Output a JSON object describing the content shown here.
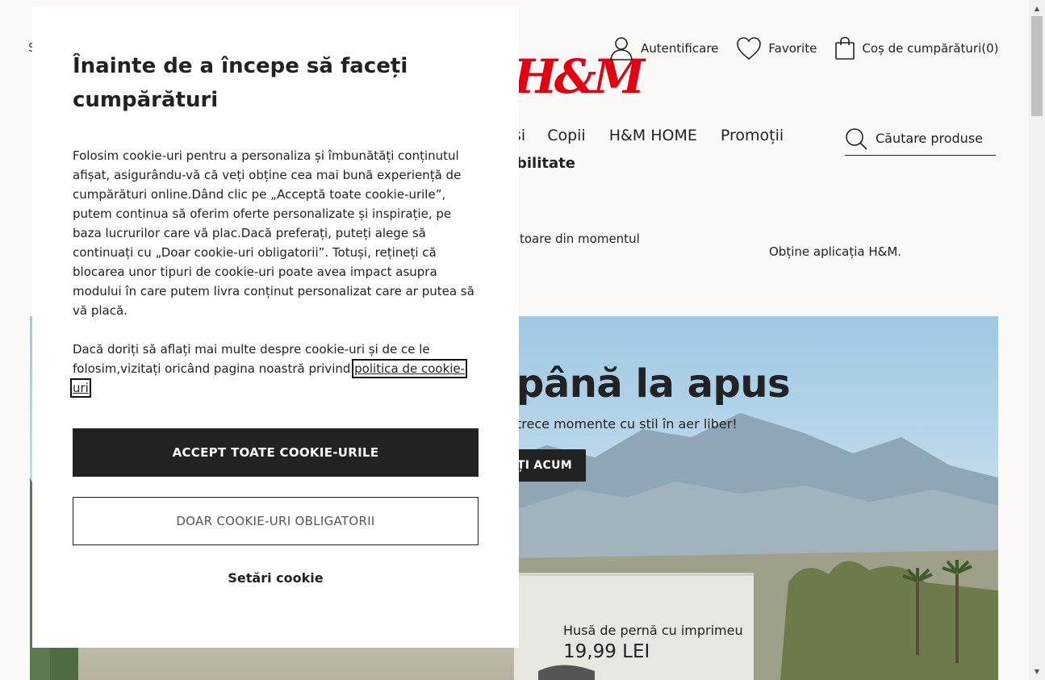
{
  "header": {
    "stray_letter": "S",
    "logo": "H&M",
    "user_links": {
      "login": "Autentificare",
      "favorites": "Favorite",
      "cart_label": "Coș de cumpărături",
      "cart_count": "(0)"
    },
    "nav": {
      "partial_first": "și",
      "items": [
        "Copii",
        "H&M HOME",
        "Promoții"
      ],
      "second_row": "bilitate"
    },
    "search_placeholder": "Căutare produse",
    "promo_left": "toare din momentul",
    "promo_right": "Obține aplicația H&M."
  },
  "hero": {
    "title": "până la apus",
    "subtitle": "trece momente cu stil în aer liber!",
    "cta": "ȚI ACUM",
    "product_name": "Husă de pernă cu imprimeu",
    "product_price": "19,99 LEI"
  },
  "cookie_modal": {
    "title": "Înainte de a începe să faceți cumpărături",
    "paragraph1": "Folosim cookie-uri pentru a personaliza și îmbunătăți conținutul afișat, asigurându-vă că veți obține cea mai bună experiență de cumpărături online.Dând clic pe „Acceptă toate cookie-urile”, putem continua să oferim oferte personalizate și inspirație, pe baza lucrurilor care vă plac.Dacă preferați, puteți alege să continuați cu „Doar cookie-uri obligatorii”. Totuși, rețineți că blocarea unor tipuri de cookie-uri poate avea impact asupra modului în care putem livra conținut personalizat care ar putea să vă placă.",
    "paragraph2_text": "Dacă doriți să aflați mai multe despre cookie-uri și de ce le folosim,vizitați oricând pagina noastră privind ",
    "policy_link": "politica de cookie-uri",
    "paragraph2_end": ".",
    "accept_all": "ACCEPT TOATE COOKIE-URILE",
    "required_only": "DOAR COOKIE-URI OBLIGATORII",
    "settings": "Setări cookie"
  },
  "colors": {
    "brand_red": "#e50010",
    "dark": "#222222",
    "page_bg": "#faf9f8"
  }
}
